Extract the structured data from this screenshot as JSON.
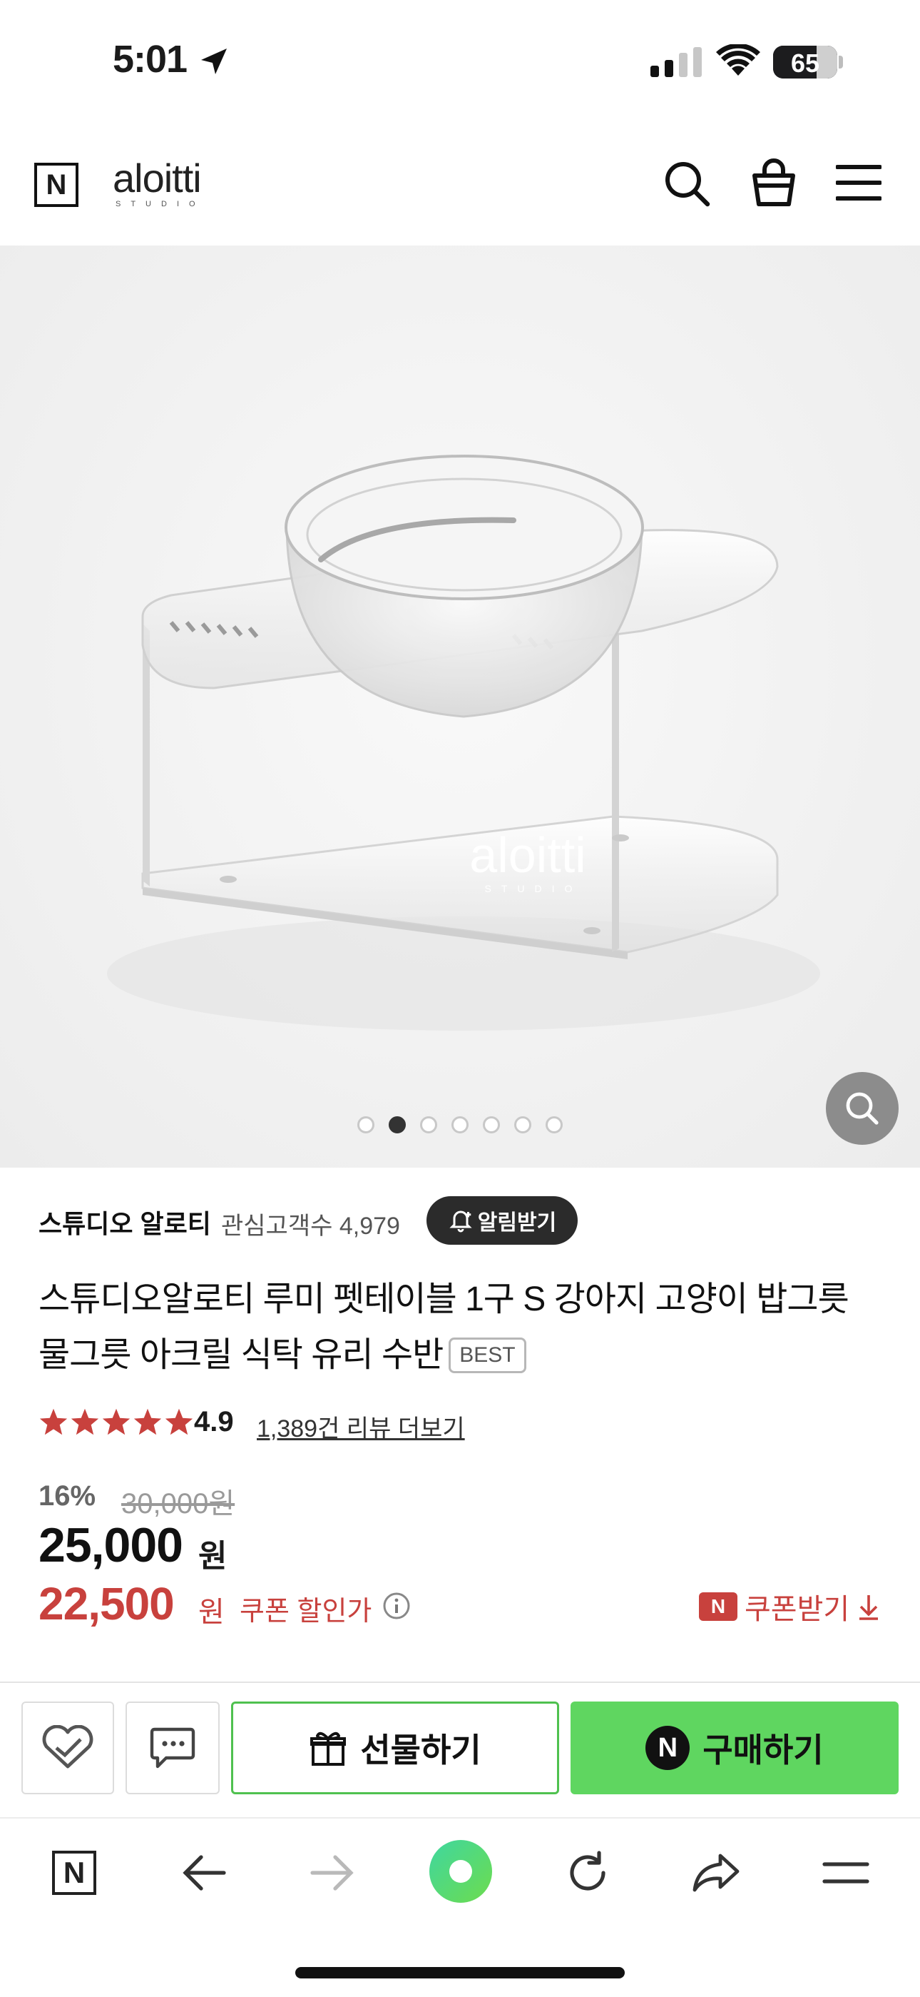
{
  "status_bar": {
    "time": "5:01",
    "battery": "65"
  },
  "header": {
    "brand_mark": "N",
    "logo_text": "aloitti",
    "logo_sub": "STUDIO"
  },
  "hero": {
    "image_count": 7,
    "active_index": 1,
    "product_logo": "aloitti",
    "product_logo_sub": "STUDIO"
  },
  "store": {
    "name": "스튜디오 알로티",
    "followers_label": "관심고객수 4,979",
    "alarm_label": "알림받기"
  },
  "product": {
    "title": "스튜디오알로티 루미 펫테이블 1구 S 강아지 고양이 밥그릇 물그릇 아크릴 식탁 유리 수반",
    "badge": "BEST"
  },
  "rating": {
    "stars": 5,
    "score": "4.9",
    "review_link": "1,389건 리뷰 더보기"
  },
  "price": {
    "discount_rate": "16%",
    "original": "30,000원",
    "sale": "25,000",
    "sale_unit": "원",
    "coupon_price": "22,500",
    "coupon_unit": "원",
    "coupon_label": "쿠폰 할인가",
    "coupon_badge": "N",
    "coupon_get": "쿠폰받기"
  },
  "actions": {
    "gift": "선물하기",
    "buy_badge": "N",
    "buy": "구매하기"
  },
  "toolbar": {
    "home_label": "N"
  },
  "colors": {
    "accent_green": "#5fd660",
    "price_red": "#c8413d",
    "star_red": "#c8413d"
  }
}
